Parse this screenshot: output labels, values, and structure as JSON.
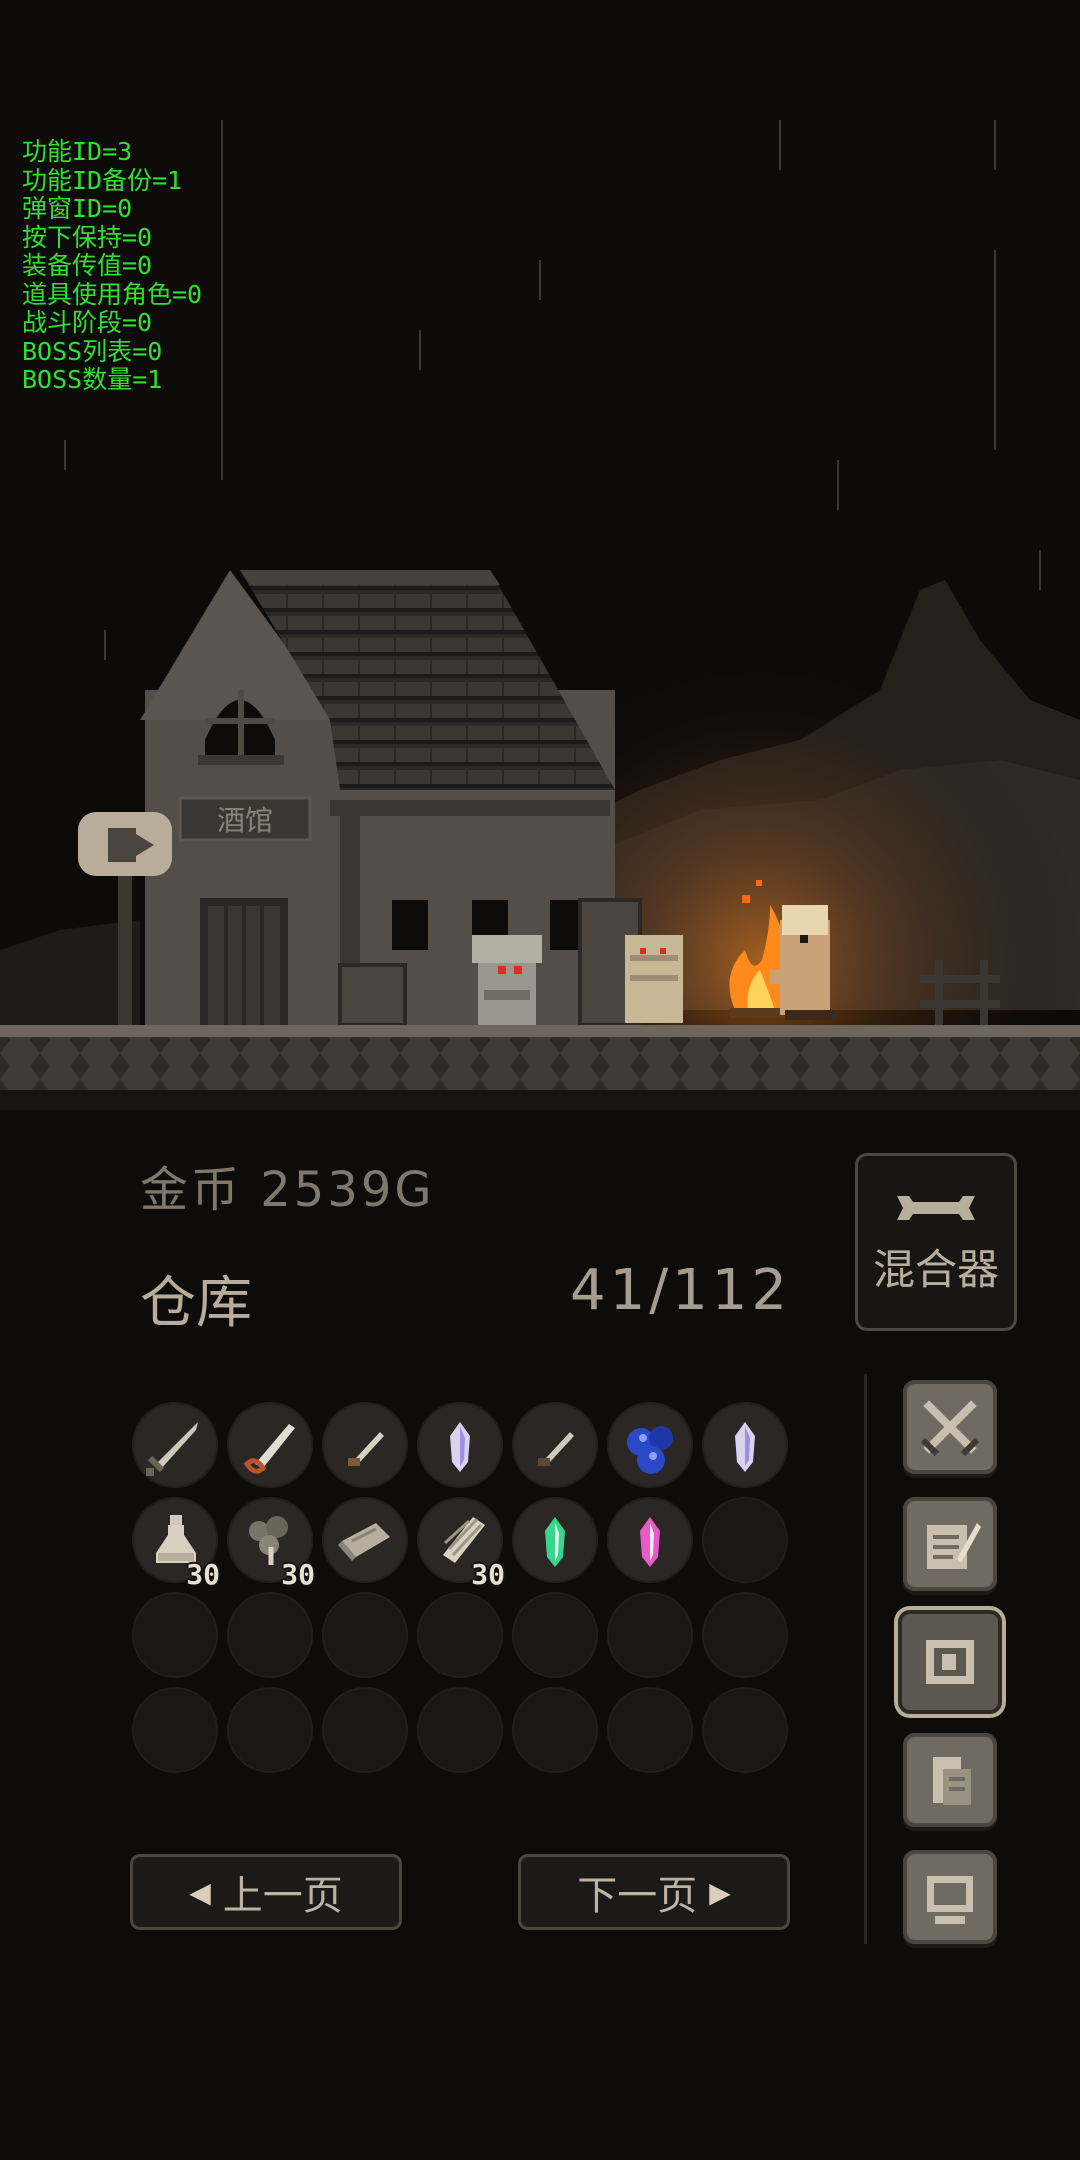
{
  "debug": {
    "lines": [
      "功能ID=3",
      "功能ID备份=1",
      "弹窗ID=0",
      "按下保持=0",
      "装备传值=0",
      "道具使用角色=0",
      "战斗阶段=0",
      "BOSS列表=0",
      "BOSS数量=1"
    ]
  },
  "scene": {
    "tavern_sign": "酒馆"
  },
  "status": {
    "gold_label": "金币 2539G",
    "storage_label": "仓库",
    "storage_count": "41/112"
  },
  "mixer": {
    "label": "混合器",
    "icon": "wrench-icon"
  },
  "inventory": {
    "rows": 4,
    "cols": 7,
    "items": [
      {
        "icon": "sword-icon",
        "qty": ""
      },
      {
        "icon": "saw-icon",
        "qty": ""
      },
      {
        "icon": "dagger-icon",
        "qty": ""
      },
      {
        "icon": "white-crystal-icon",
        "qty": ""
      },
      {
        "icon": "knife-icon",
        "qty": ""
      },
      {
        "icon": "blue-orbs-icon",
        "qty": ""
      },
      {
        "icon": "white-crystal-icon",
        "qty": ""
      },
      {
        "icon": "potion-icon",
        "qty": "30"
      },
      {
        "icon": "herb-icon",
        "qty": "30"
      },
      {
        "icon": "scroll-icon",
        "qty": ""
      },
      {
        "icon": "bandage-icon",
        "qty": "30"
      },
      {
        "icon": "green-crystal-icon",
        "qty": ""
      },
      {
        "icon": "pink-crystal-icon",
        "qty": ""
      }
    ]
  },
  "sidebar": {
    "buttons": [
      {
        "icon": "crossed-swords-icon",
        "active": false
      },
      {
        "icon": "quill-scroll-icon",
        "active": false
      },
      {
        "icon": "storage-icon",
        "active": true
      },
      {
        "icon": "book-icon",
        "active": false
      },
      {
        "icon": "computer-icon",
        "active": false
      }
    ]
  },
  "nav": {
    "prev": "上一页",
    "next": "下一页"
  },
  "colors": {
    "debug_text": "#2fe02f",
    "background": "#0d0c0b",
    "fire": "#ff8a1c"
  }
}
